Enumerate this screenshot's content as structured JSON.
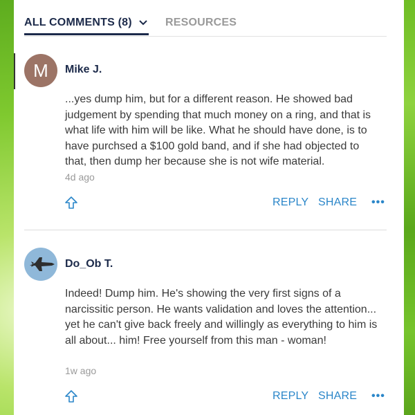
{
  "tabs": {
    "comments_label": "ALL COMMENTS (8)",
    "resources_label": "RESOURCES"
  },
  "comments": [
    {
      "avatar_letter": "M",
      "author": "Mike J.",
      "text": "...yes dump him, but for a different reason. He showed bad judgement by spending that much money on a ring, and that is what life with him will be like. What he should have done, is to have purchsed a $100 gold band, and if she had objected to that, then dump her because she is not wife material.",
      "time": "4d ago",
      "reply_label": "REPLY",
      "share_label": "SHARE",
      "more_label": "•••"
    },
    {
      "avatar_letter": "",
      "author": "Do_Ob T.",
      "text": "Indeed! Dump him.  He's showing the very first signs of a narcissitic person.  He wants validation and loves the attention... yet he can't give back freely and willingly as everything to him is all about... him!  Free yourself from this man - woman!",
      "time": "1w ago",
      "reply_label": "REPLY",
      "share_label": "SHARE",
      "more_label": "•••"
    }
  ],
  "colors": {
    "tab_active": "#1c2a4a",
    "action_blue": "#2a86c9",
    "avatar_m": "#9c7466",
    "avatar_jet": "#8fb8d9"
  },
  "icons": {
    "upvote": "arrow-up-outline-icon",
    "dropdown": "chevron-down-icon",
    "jet_avatar": "fighter-jet-icon"
  }
}
